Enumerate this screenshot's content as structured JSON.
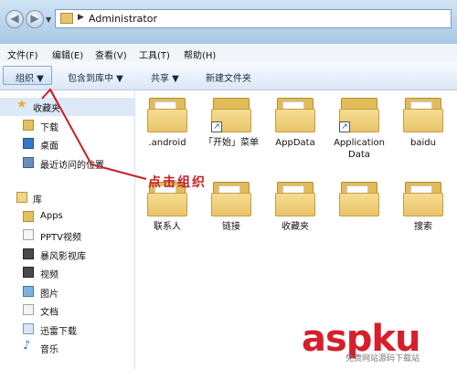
{
  "address": {
    "path": "Administrator"
  },
  "menu": [
    "文件(F)",
    "编辑(E)",
    "查看(V)",
    "工具(T)",
    "帮助(H)"
  ],
  "toolbar": {
    "organize": "组织 ▼",
    "include": "包含到库中 ▼",
    "share": "共享 ▼",
    "new_folder": "新建文件夹"
  },
  "sidebar": {
    "favorites": "收藏夹",
    "fav_items": [
      "下载",
      "桌面",
      "最近访问的位置"
    ],
    "libraries": "库",
    "lib_items": [
      "Apps",
      "PPTV视频",
      "暴风影视库",
      "视频",
      "图片",
      "文档",
      "迅雷下载",
      "音乐"
    ]
  },
  "files": [
    {
      "name": ".android",
      "shortcut": false
    },
    {
      "name": "「开始」菜单",
      "shortcut": true
    },
    {
      "name": "AppData",
      "shortcut": false
    },
    {
      "name": "Application Data",
      "shortcut": true
    },
    {
      "name": "baidu",
      "shortcut": false
    },
    {
      "name": "联系人",
      "shortcut": false
    },
    {
      "name": "链接",
      "shortcut": false
    },
    {
      "name": "收藏夹",
      "shortcut": false
    },
    {
      "name": "",
      "shortcut": false
    },
    {
      "name": "搜索",
      "shortcut": false
    }
  ],
  "annotation": {
    "text": "点击组织",
    "color": "#c8202a"
  },
  "watermark": {
    "brand": "aspku",
    "sub": "免费网站源码下载站"
  },
  "colors": {
    "accent": "#3a78c2",
    "folder": "#e9c46a"
  }
}
